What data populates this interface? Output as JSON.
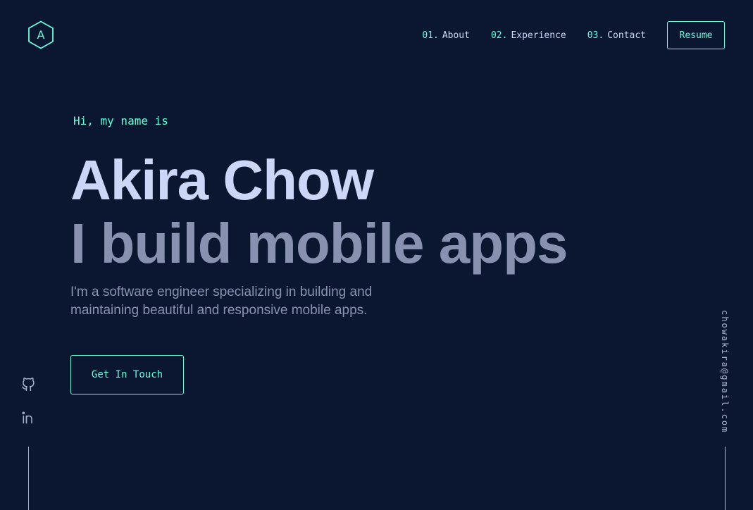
{
  "logo": {
    "letter": "A",
    "icon": "hexagon-logo-icon"
  },
  "nav": {
    "items": [
      {
        "num": "01.",
        "label": "About"
      },
      {
        "num": "02.",
        "label": "Experience"
      },
      {
        "num": "03.",
        "label": "Contact"
      }
    ],
    "resume_label": "Resume"
  },
  "hero": {
    "greeting": "Hi, my name is",
    "name": "Akira Chow",
    "tagline": "I build mobile apps",
    "intro": "I'm a software engineer specializing in building and maintaining beautiful and responsive mobile apps.",
    "cta_label": "Get In Touch"
  },
  "socials": [
    {
      "name": "github-icon"
    },
    {
      "name": "linkedin-icon"
    }
  ],
  "email": "chowakira@gmail.com",
  "colors": {
    "background": "#0b1730",
    "accent": "#64ffda",
    "heading": "#ccd6f6",
    "muted": "#8892b0"
  }
}
